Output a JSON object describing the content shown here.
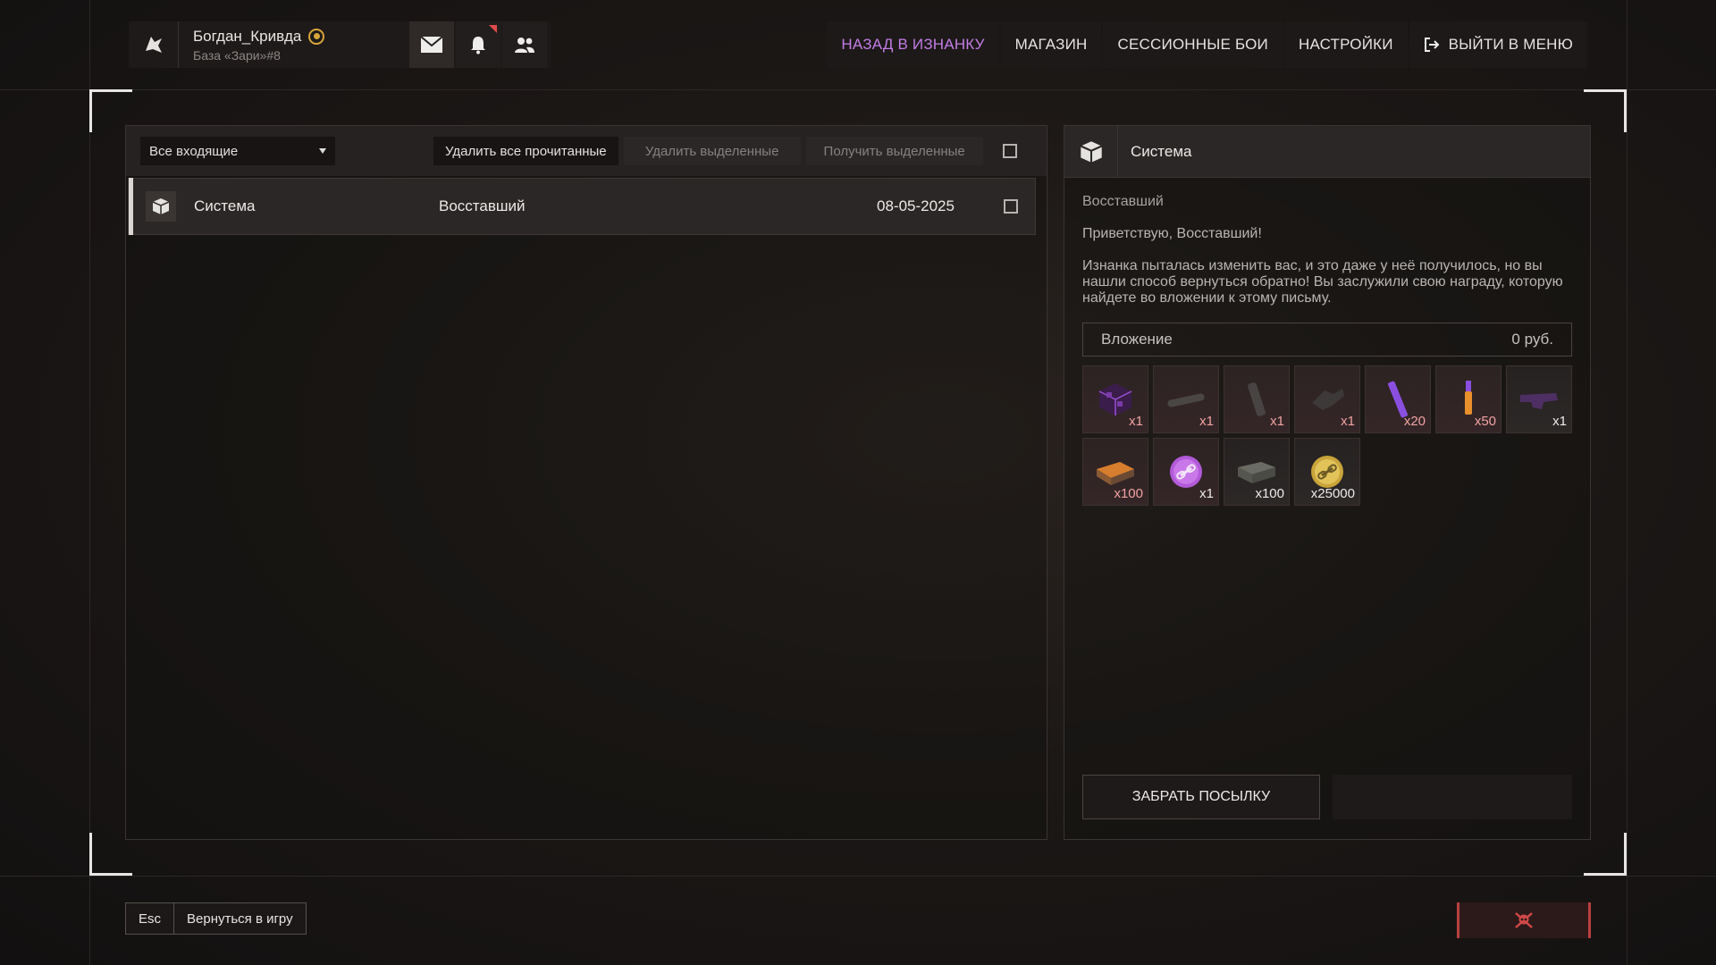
{
  "profile": {
    "nickname": "Богдан_Кривда",
    "base": "База «Зари»#8",
    "icons": [
      "logo-icon",
      "rank-badge-icon",
      "mail-icon",
      "bell-icon",
      "friends-icon"
    ]
  },
  "nav": {
    "back": "НАЗАД В ИЗНАНКУ",
    "shop": "МАГАЗИН",
    "session_battles": "СЕССИОННЫЕ БОИ",
    "settings": "НАСТРОЙКИ",
    "exit": "ВЫЙТИ В МЕНЮ"
  },
  "mail_list": {
    "filter": "Все входящие",
    "delete_read": "Удалить все прочитанные",
    "delete_selected": "Удалить выделенные",
    "receive_selected": "Получить выделенные",
    "messages": [
      {
        "sender": "Система",
        "subject": "Восставший",
        "date": "08-05-2025"
      }
    ]
  },
  "message": {
    "sender": "Система",
    "subject": "Восставший",
    "greeting": "Приветствую, Восставший!",
    "body": "Изнанка пыталась изменить вас, и это даже у неё получилось, но вы нашли способ вернуться обратно! Вы заслужили свою награду, которую найдете во вложении к этому письму.",
    "attachment_label": "Вложение",
    "attachment_value": "0 руб.",
    "items": [
      {
        "icon": "purple-cube-icon",
        "qty": "x1"
      },
      {
        "icon": "silencer-icon",
        "qty": "x1"
      },
      {
        "icon": "grip-icon",
        "qty": "x1"
      },
      {
        "icon": "scope-mount-icon",
        "qty": "x1"
      },
      {
        "icon": "purple-stick-icon",
        "qty": "x20"
      },
      {
        "icon": "orange-vial-icon",
        "qty": "x50"
      },
      {
        "icon": "purple-weapon-part-icon",
        "qty": "x1"
      },
      {
        "icon": "orange-box-icon",
        "qty": "x100"
      },
      {
        "icon": "purple-link-coin-icon",
        "qty": "x1"
      },
      {
        "icon": "ammo-crate-icon",
        "qty": "x100"
      },
      {
        "icon": "gold-link-coin-icon",
        "qty": "x25000"
      }
    ],
    "take_button": "ЗАБРАТЬ ПОСЫЛКУ"
  },
  "bottom": {
    "esc": "Esc",
    "return": "Вернуться в игру"
  },
  "colors": {
    "accent_purple": "#c47de6",
    "notif_red": "#e24b4b",
    "qty_red": "#f1a2a2"
  }
}
